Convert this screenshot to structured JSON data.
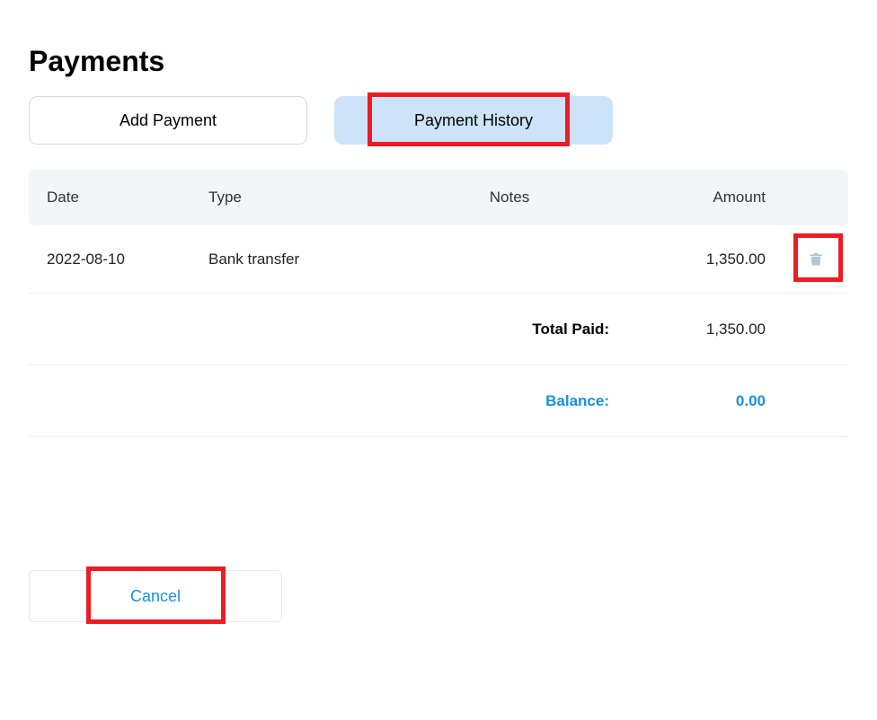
{
  "title": "Payments",
  "tabs": {
    "add": "Add Payment",
    "history": "Payment History"
  },
  "headers": {
    "date": "Date",
    "type": "Type",
    "notes": "Notes",
    "amount": "Amount"
  },
  "rows": [
    {
      "date": "2022-08-10",
      "type": "Bank transfer",
      "notes": "",
      "amount": "1,350.00"
    }
  ],
  "summary": {
    "totalPaidLabel": "Total Paid:",
    "totalPaidValue": "1,350.00",
    "balanceLabel": "Balance:",
    "balanceValue": "0.00"
  },
  "actions": {
    "cancel": "Cancel"
  }
}
